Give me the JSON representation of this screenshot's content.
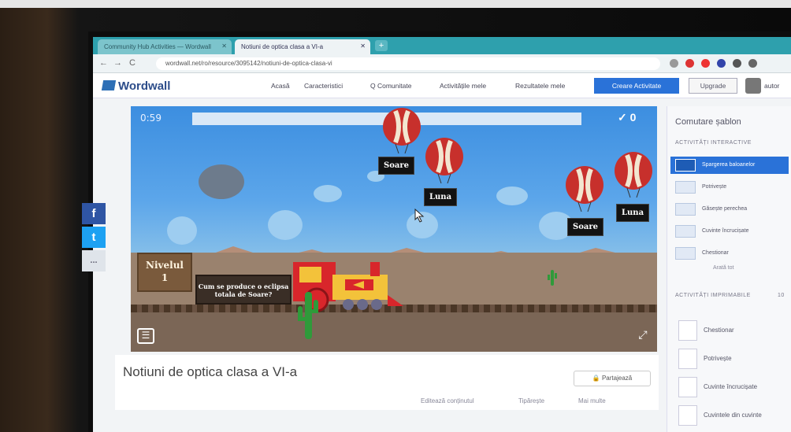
{
  "browser": {
    "tabs": [
      {
        "label": "Community Hub Activities — Wordwall",
        "active": false
      },
      {
        "label": "Notiuni de optica clasa a VI-a",
        "active": true
      }
    ],
    "new_tab": "+",
    "url": "wordwall.net/ro/resource/3095142/notiuni-de-optica-clasa-vi",
    "nav": {
      "back": "←",
      "forward": "→",
      "reload": "C"
    }
  },
  "header": {
    "logo": "Wordwall",
    "nav": [
      "Acasă",
      "Caracteristici",
      "Q Comunitate",
      "Activitățile mele",
      "Rezultatele mele"
    ],
    "create_button": "Creare Activitate",
    "upgrade_button": "Upgrade",
    "username": "autor"
  },
  "social": {
    "facebook": "f",
    "twitter": "t",
    "more": "..."
  },
  "game": {
    "timer": "0:59",
    "score": "✓ 0",
    "answers": [
      {
        "text": "Soare"
      },
      {
        "text": "Luna"
      },
      {
        "text": "Soare"
      },
      {
        "text": "Luna"
      }
    ],
    "level_label": "Nivelul",
    "level_number": "1",
    "question": "Cum se produce o eclipsa totala de Soare?",
    "menu_icon": "☰",
    "fullscreen_icon": "⤢"
  },
  "activity": {
    "title": "Notiuni de optica clasa a VI-a",
    "share_button": "Partajează",
    "meta": [
      "Editează conținutul",
      "Tipărește",
      "Mai multe"
    ]
  },
  "panel": {
    "title": "Comutare șablon",
    "interactive_section": "ACTIVITĂȚI INTERACTIVE",
    "interactive": [
      {
        "label": "Spargerea baloanelor",
        "selected": true
      },
      {
        "label": "Potrivește",
        "selected": false
      },
      {
        "label": "Găsește perechea",
        "selected": false
      },
      {
        "label": "Cuvinte încrucișate",
        "selected": false
      },
      {
        "label": "Chestionar",
        "selected": false
      }
    ],
    "more_link": "Arată tot",
    "printable_section": "ACTIVITĂȚI IMPRIMABILE",
    "printable_count": "10",
    "printable": [
      "Chestionar",
      "Potrivește",
      "Cuvinte încrucișate",
      "Cuvintele din cuvinte"
    ]
  },
  "colors": {
    "sky": "#3c8ee0",
    "accent": "#2a72d8",
    "ground": "#9a826e",
    "train": "#d8262b"
  }
}
